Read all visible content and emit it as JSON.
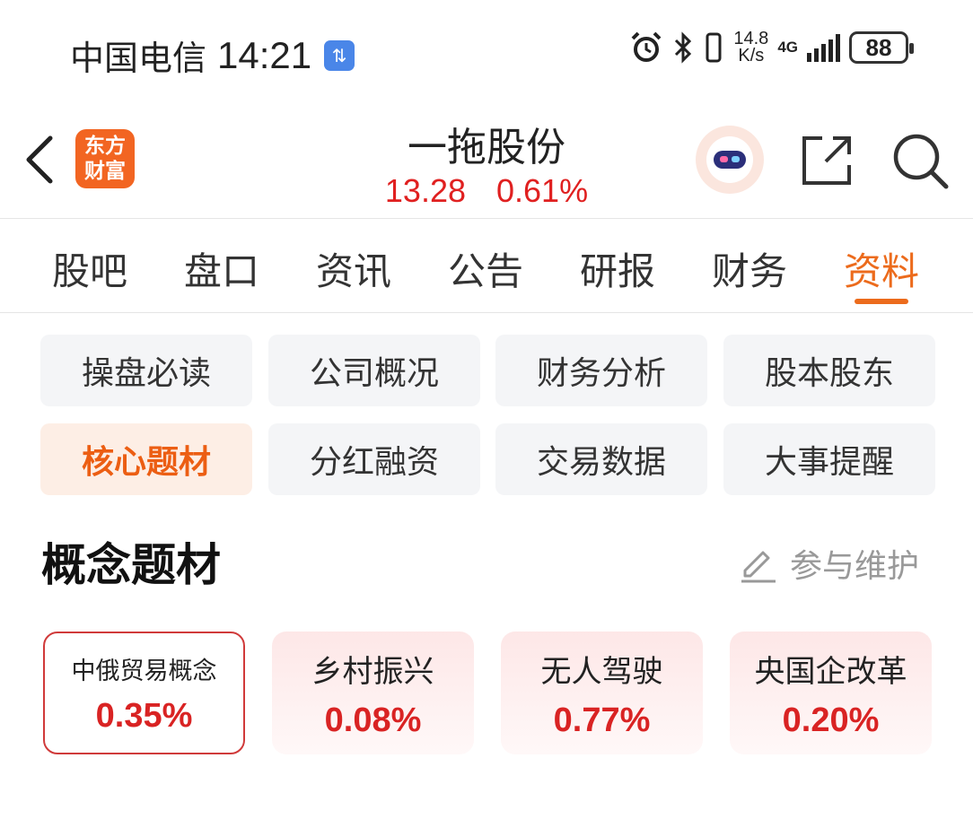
{
  "status_bar": {
    "carrier": "中国电信",
    "time": "14:21",
    "net_speed_value": "14.8",
    "net_speed_unit": "K/s",
    "network": "4G",
    "battery": "88"
  },
  "header": {
    "logo_line1": "东方",
    "logo_line2": "财富",
    "stock_name": "一拖股份",
    "price": "13.28",
    "change_pct": "0.61%"
  },
  "tabs": [
    {
      "label": "股吧"
    },
    {
      "label": "盘口"
    },
    {
      "label": "资讯"
    },
    {
      "label": "公告"
    },
    {
      "label": "研报"
    },
    {
      "label": "财务"
    },
    {
      "label": "资料",
      "active": true
    }
  ],
  "sub_buttons": [
    {
      "label": "操盘必读"
    },
    {
      "label": "公司概况"
    },
    {
      "label": "财务分析"
    },
    {
      "label": "股本股东"
    },
    {
      "label": "核心题材",
      "active": true
    },
    {
      "label": "分红融资"
    },
    {
      "label": "交易数据"
    },
    {
      "label": "大事提醒"
    }
  ],
  "section": {
    "title": "概念题材",
    "maintain_label": "参与维护"
  },
  "concepts": [
    {
      "name": "中俄贸易概念",
      "pct": "0.35%",
      "selected": true
    },
    {
      "name": "乡村振兴",
      "pct": "0.08%"
    },
    {
      "name": "无人驾驶",
      "pct": "0.77%"
    },
    {
      "name": "央国企改革",
      "pct": "0.20%"
    }
  ],
  "colors": {
    "accent": "#ec6b1c",
    "up_red": "#e02020",
    "logo_bg": "#f26522"
  }
}
